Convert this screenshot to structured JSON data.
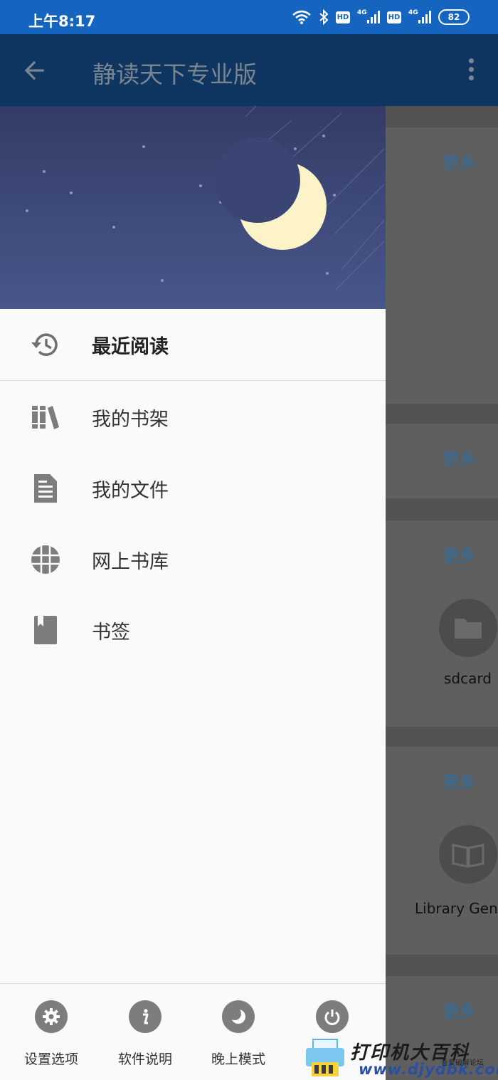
{
  "status_bar": {
    "time": "上午8:17",
    "icons": [
      "wifi-icon",
      "bluetooth-icon",
      "hd-icon",
      "signal-4g-icon",
      "hd-icon",
      "signal-4g-icon"
    ],
    "hd_label": "HD",
    "net_label": "4G",
    "battery": "82"
  },
  "app_bar": {
    "title": "静读天下专业版",
    "back_icon": "arrow-left-icon",
    "menu_icon": "more-vert-icon"
  },
  "drawer": {
    "header_image": "night-sky-moon",
    "items": [
      {
        "label": "最近阅读",
        "icon": "history-icon",
        "active": true
      },
      {
        "label": "我的书架",
        "icon": "bookshelf-icon"
      },
      {
        "label": "我的文件",
        "icon": "document-icon"
      },
      {
        "label": "网上书库",
        "icon": "globe-grid-icon"
      },
      {
        "label": "书签",
        "icon": "bookmark-icon"
      }
    ],
    "bottom_actions": [
      {
        "label": "设置选项",
        "icon": "gear-icon"
      },
      {
        "label": "软件说明",
        "icon": "info-icon"
      },
      {
        "label": "晚上模式",
        "icon": "moon-icon"
      },
      {
        "label": "",
        "icon": "power-icon"
      }
    ]
  },
  "background": {
    "more_label": "更多",
    "folder_label": "sdcard",
    "library_label": "Library Gene"
  },
  "watermark": {
    "line1": "打印机大百科",
    "line2": "www.djydbk.com",
    "line3": "吾爱破解论坛"
  },
  "colors": {
    "status_bar": "#1565c0",
    "app_bar_dimmed": "#0e3660",
    "drawer_bg": "#fafafa",
    "icon_gray": "#7d7d7d",
    "link_blue_dimmed": "#2e6ea0"
  }
}
